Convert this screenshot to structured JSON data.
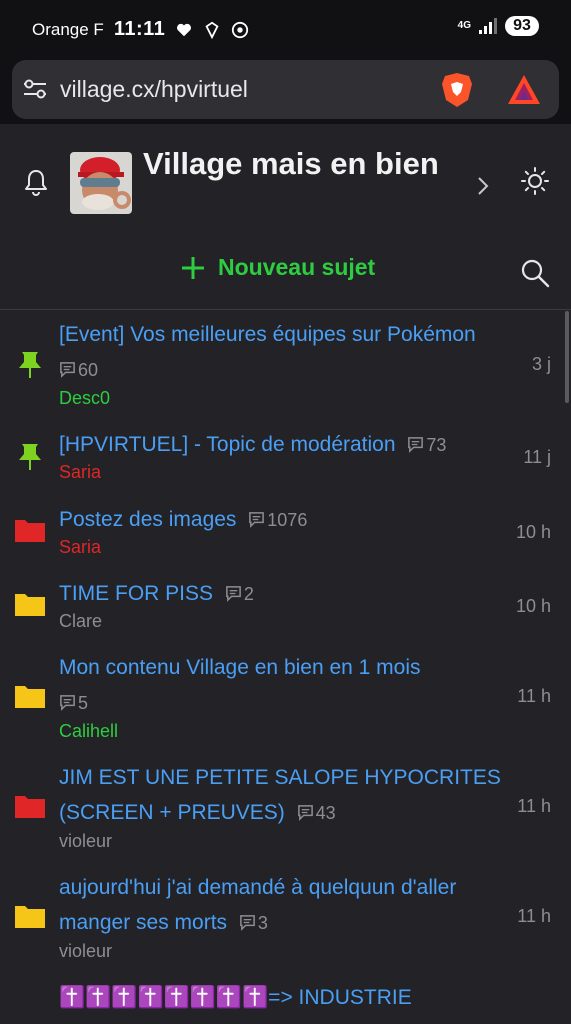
{
  "status_bar": {
    "carrier": "Orange F",
    "time": "11:11",
    "network": "4G",
    "battery": "93"
  },
  "browser": {
    "url": "village.cx/hpvirtuel"
  },
  "forum": {
    "title": "Village mais en bien",
    "new_topic_label": "Nouveau sujet"
  },
  "colors": {
    "accent_green": "#2ecc40",
    "link_blue": "#4a9ff5",
    "admin_red": "#e02626",
    "folder_yellow": "#f5c518",
    "pin_green": "#7ed321"
  },
  "topics": [
    {
      "icon": "pin-icon",
      "title": "[Event] Vos meilleures équipes sur Pokémon",
      "replies": "60",
      "author": "Desc0",
      "author_color": "#2ecc40",
      "time": "3 j"
    },
    {
      "icon": "pin-icon",
      "title": "[HPVIRTUEL] - Topic de modération",
      "replies": "73",
      "author": "Saria",
      "author_color": "#e02626",
      "time": "11 j"
    },
    {
      "icon": "red-folder-icon",
      "title": "Postez des images",
      "replies": "1076",
      "author": "Saria",
      "author_color": "#e02626",
      "time": "10 h"
    },
    {
      "icon": "folder-icon",
      "title": "TIME FOR PISS",
      "replies": "2",
      "author": "Clare",
      "author_color": "#8d8d93",
      "time": "10 h"
    },
    {
      "icon": "folder-icon",
      "title": "Mon contenu Village en bien en 1 mois",
      "replies": "5",
      "author": "Calihell",
      "author_color": "#2ecc40",
      "time": "11 h"
    },
    {
      "icon": "red-folder-icon",
      "title": "JIM EST UNE PETITE SALOPE HYPOCRITES (SCREEN + PREUVES)",
      "replies": "43",
      "author": "violeur",
      "author_color": "#8d8d93",
      "time": "11 h"
    },
    {
      "icon": "folder-icon",
      "title": "aujourd'hui j'ai demandé à quelquun d'aller manger ses morts",
      "replies": "3",
      "author": "violeur",
      "author_color": "#8d8d93",
      "time": "11 h"
    },
    {
      "icon": "folder-icon",
      "title": "✝️✝️✝️✝️✝️✝️✝️✝️=> INDUSTRIE",
      "replies": "",
      "author": "",
      "author_color": "#8d8d93",
      "time": ""
    }
  ]
}
